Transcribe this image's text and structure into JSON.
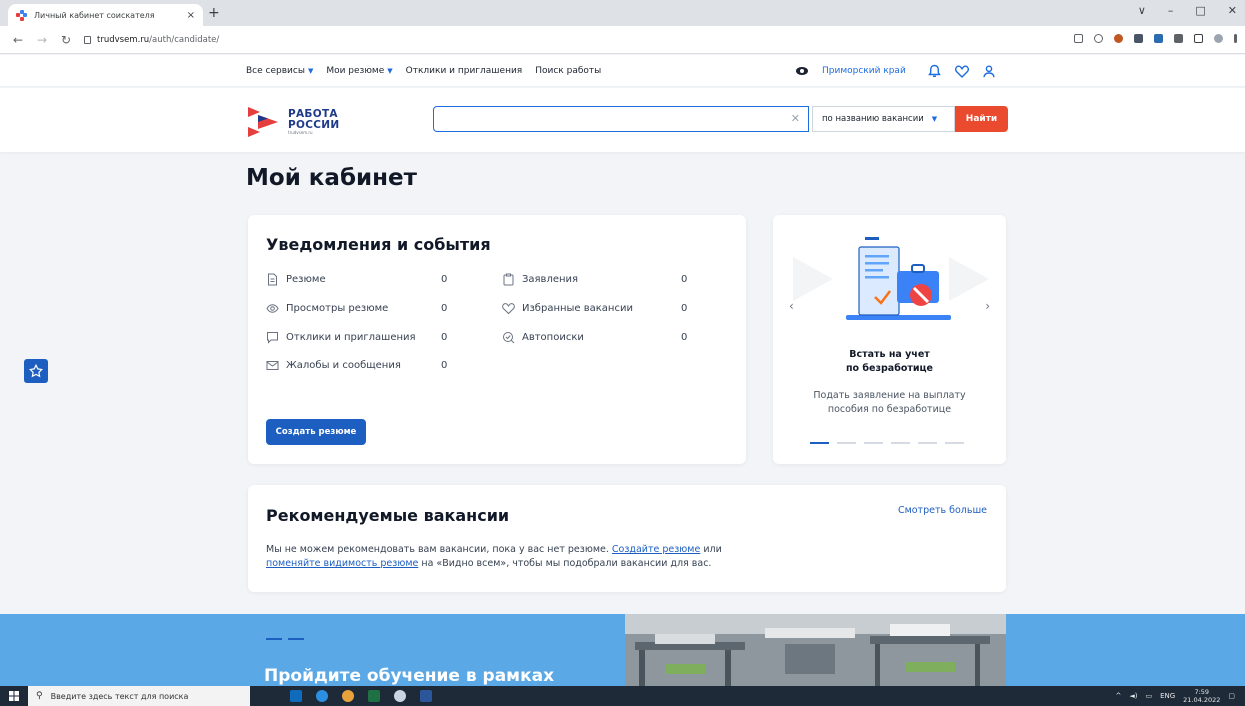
{
  "browser": {
    "tab_title": "Личный кабинет соискателя",
    "new_tab": "+",
    "close_tab": "×",
    "url_host": "trudvsem.ru",
    "url_path": "/auth/candidate/",
    "window_controls": [
      "∨",
      "–",
      "□",
      "✕"
    ]
  },
  "topnav": {
    "items": [
      {
        "label": "Все сервисы",
        "dropdown": true
      },
      {
        "label": "Мои резюме",
        "dropdown": true
      },
      {
        "label": "Отклики и приглашения",
        "dropdown": false
      },
      {
        "label": "Поиск работы",
        "dropdown": false
      }
    ],
    "region": "Приморский край"
  },
  "header": {
    "logo_line1": "РАБОТА",
    "logo_line2": "РОССИИ",
    "logo_sub": "trudvsem.ru",
    "search_value": "",
    "search_mode": "по названию вакансии",
    "search_button": "Найти",
    "clear_glyph": "✕"
  },
  "page": {
    "title": "Мой кабинет"
  },
  "notifications": {
    "title": "Уведомления и события",
    "items": [
      {
        "label": "Резюме",
        "count": "0",
        "icon": "document-icon"
      },
      {
        "label": "Просмотры резюме",
        "count": "0",
        "icon": "eye-icon"
      },
      {
        "label": "Отклики и приглашения",
        "count": "0",
        "icon": "chat-icon"
      },
      {
        "label": "Жалобы и сообщения",
        "count": "0",
        "icon": "mail-icon"
      },
      {
        "label": "Заявления",
        "count": "0",
        "icon": "clipboard-icon"
      },
      {
        "label": "Избранные вакансии",
        "count": "0",
        "icon": "heart-icon"
      },
      {
        "label": "Автопоиски",
        "count": "0",
        "icon": "autosearch-icon"
      }
    ],
    "create_button": "Создать резюме"
  },
  "promo": {
    "title_line1": "Встать на учет",
    "title_line2": "по безработице",
    "text_line1": "Подать заявление на выплату",
    "text_line2": "пособия по безработице",
    "prev": "‹",
    "next": "›",
    "slides": 6,
    "active_slide": 0
  },
  "recommended": {
    "title": "Рекомендуемые вакансии",
    "more": "Смотреть больше",
    "text_1": "Мы не можем рекомендовать вам вакансии, пока у вас нет резюме.",
    "link_1": "Создайте резюме",
    "text_2": "или",
    "link_2": "поменяйте видимость резюме",
    "text_3": "на «Видно всем», чтобы мы подобрали вакансии для вас."
  },
  "banner": {
    "title": "Пройдите обучение в рамках"
  },
  "taskbar": {
    "search_placeholder": "Введите здесь текст для поиска",
    "lang": "ENG",
    "time": "7:59",
    "date": "21.04.2022"
  },
  "colors": {
    "accent": "#1d5fc0",
    "link": "#1d6ce0",
    "search_button": "#ea4b2f",
    "banner": "#5aa9e6"
  }
}
